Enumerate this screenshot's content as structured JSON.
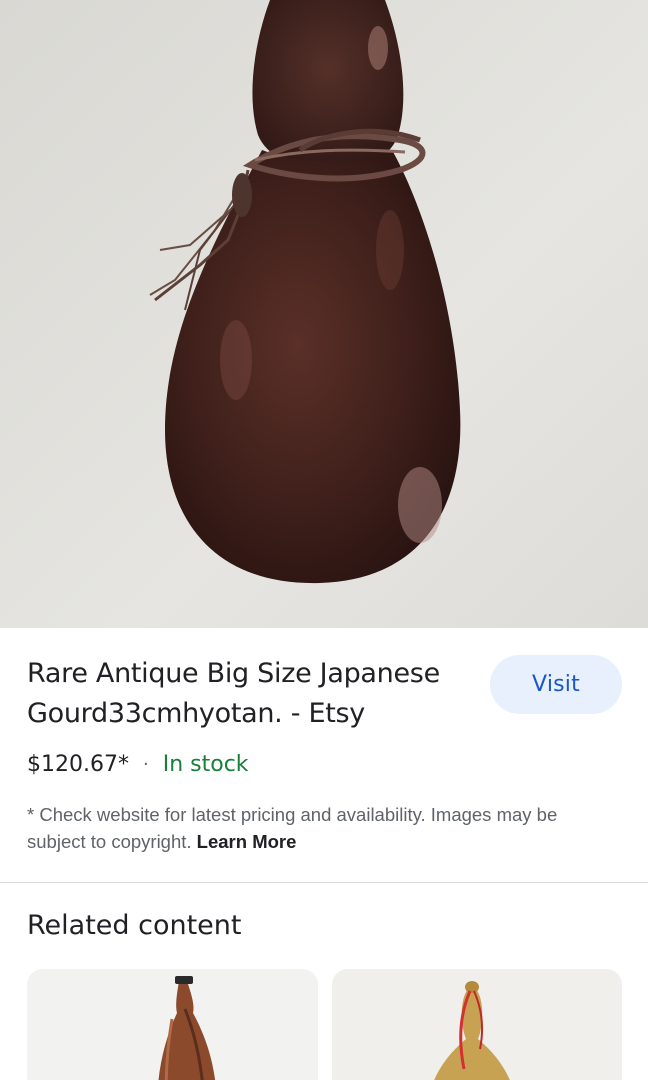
{
  "product": {
    "title": "Rare Antique Big Size Japanese Gourd33cmhyotan. - Etsy",
    "visit_label": "Visit",
    "price": "$120.67*",
    "separator": "·",
    "stock_status": "In stock",
    "disclaimer": "* Check website for latest pricing and availability. Images may be subject to copyright.",
    "learn_more": "Learn More"
  },
  "related": {
    "heading": "Related content",
    "cards": [
      {
        "icon": "gourd-image"
      },
      {
        "icon": "gourd-image"
      }
    ]
  },
  "colors": {
    "accent": "#1a56c4",
    "button_bg": "#e8f0fe",
    "in_stock": "#188038",
    "text": "#202124",
    "muted": "#5f6368"
  }
}
